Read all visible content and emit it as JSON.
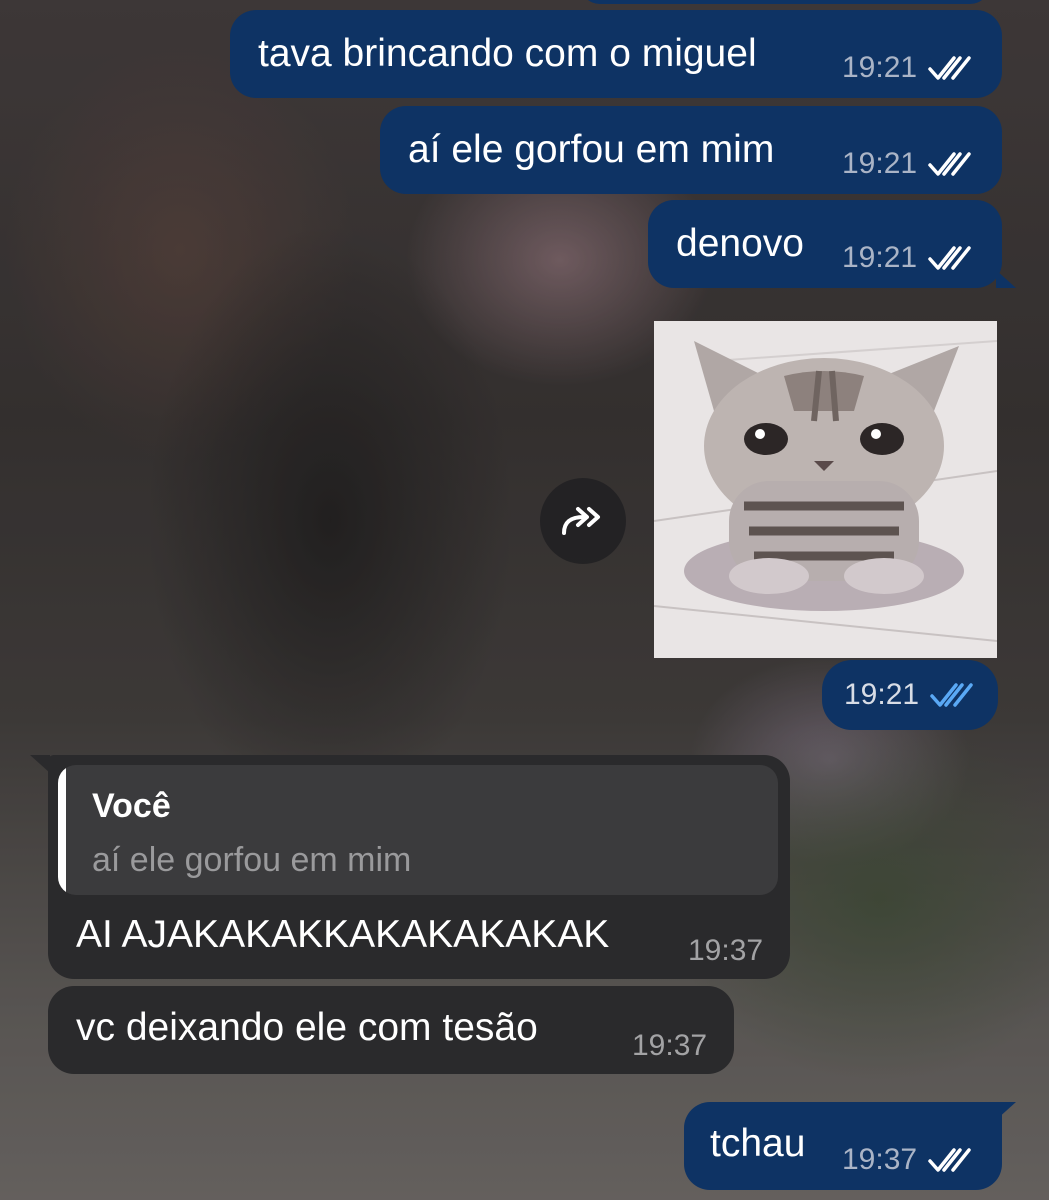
{
  "chat": {
    "messages": [
      {
        "id": "m1",
        "direction": "outgoing",
        "text": "tava brincando com o miguel",
        "time": "19:21",
        "status": "read"
      },
      {
        "id": "m2",
        "direction": "outgoing",
        "text": "aí ele gorfou em mim",
        "time": "19:21",
        "status": "read"
      },
      {
        "id": "m3",
        "direction": "outgoing",
        "text": "denovo",
        "time": "19:21",
        "status": "read"
      },
      {
        "id": "m4",
        "direction": "outgoing",
        "type": "sticker",
        "sticker": "sad-kitten",
        "time": "19:21",
        "status": "read"
      },
      {
        "id": "m5",
        "direction": "incoming",
        "reply_to": {
          "author": "Você",
          "text": "aí ele gorfou em mim"
        },
        "text": "AI AJAKAKAKKAKAKAKAKAK",
        "time": "19:37"
      },
      {
        "id": "m6",
        "direction": "incoming",
        "text": "vc deixando ele com tesão",
        "time": "19:37"
      },
      {
        "id": "m7",
        "direction": "outgoing",
        "text": "tchau",
        "time": "19:37",
        "status": "read"
      }
    ]
  },
  "icons": {
    "read_receipt": "double-check-icon",
    "forward": "forward-icon"
  },
  "colors": {
    "outgoing_bubble": "#0e3364",
    "incoming_bubble": "#2a2a2c",
    "reply_box": "#3b3b3d",
    "check_default": "#ffffff",
    "check_sticker": "#5aa9f5"
  }
}
